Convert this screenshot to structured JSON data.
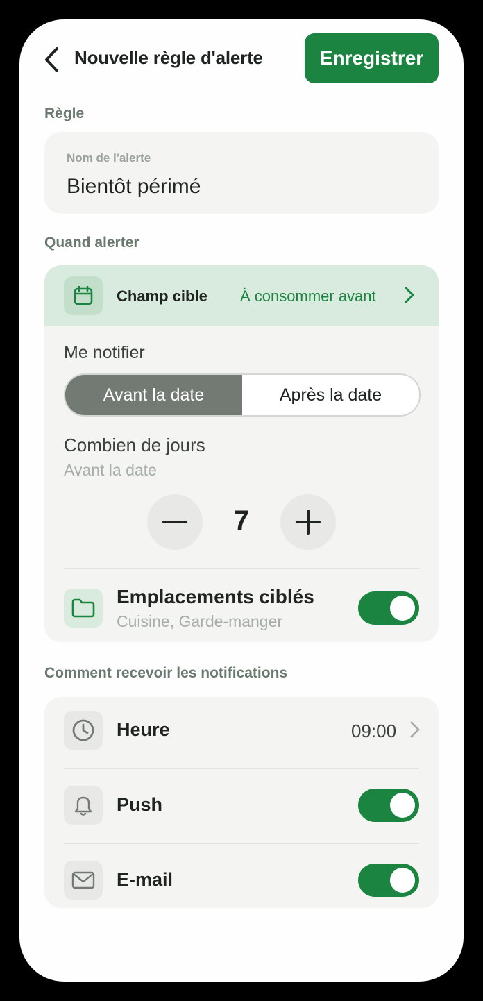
{
  "header": {
    "title": "Nouvelle règle d'alerte",
    "save_label": "Enregistrer"
  },
  "rule": {
    "section_label": "Règle",
    "field_label": "Nom de l'alerte",
    "field_value": "Bientôt périmé"
  },
  "when": {
    "section_label": "Quand alerter",
    "target_label": "Champ cible",
    "target_value": "À consommer avant",
    "notify_label": "Me notifier",
    "segments": [
      {
        "label": "Avant la date",
        "active": true
      },
      {
        "label": "Après la date",
        "active": false
      }
    ],
    "days_label": "Combien de jours",
    "days_sub": "Avant la date",
    "days_value": "7",
    "locations_title": "Emplacements ciblés",
    "locations_sub": "Cuisine, Garde-manger",
    "locations_enabled": true
  },
  "notifications": {
    "section_label": "Comment recevoir les notifications",
    "time_label": "Heure",
    "time_value": "09:00",
    "push_label": "Push",
    "push_enabled": true,
    "email_label": "E-mail",
    "email_enabled": true
  },
  "colors": {
    "accent": "#1a8440",
    "accent_light": "#d9ebde",
    "card_bg": "#f4f4f2",
    "segment_active": "#727a73"
  }
}
